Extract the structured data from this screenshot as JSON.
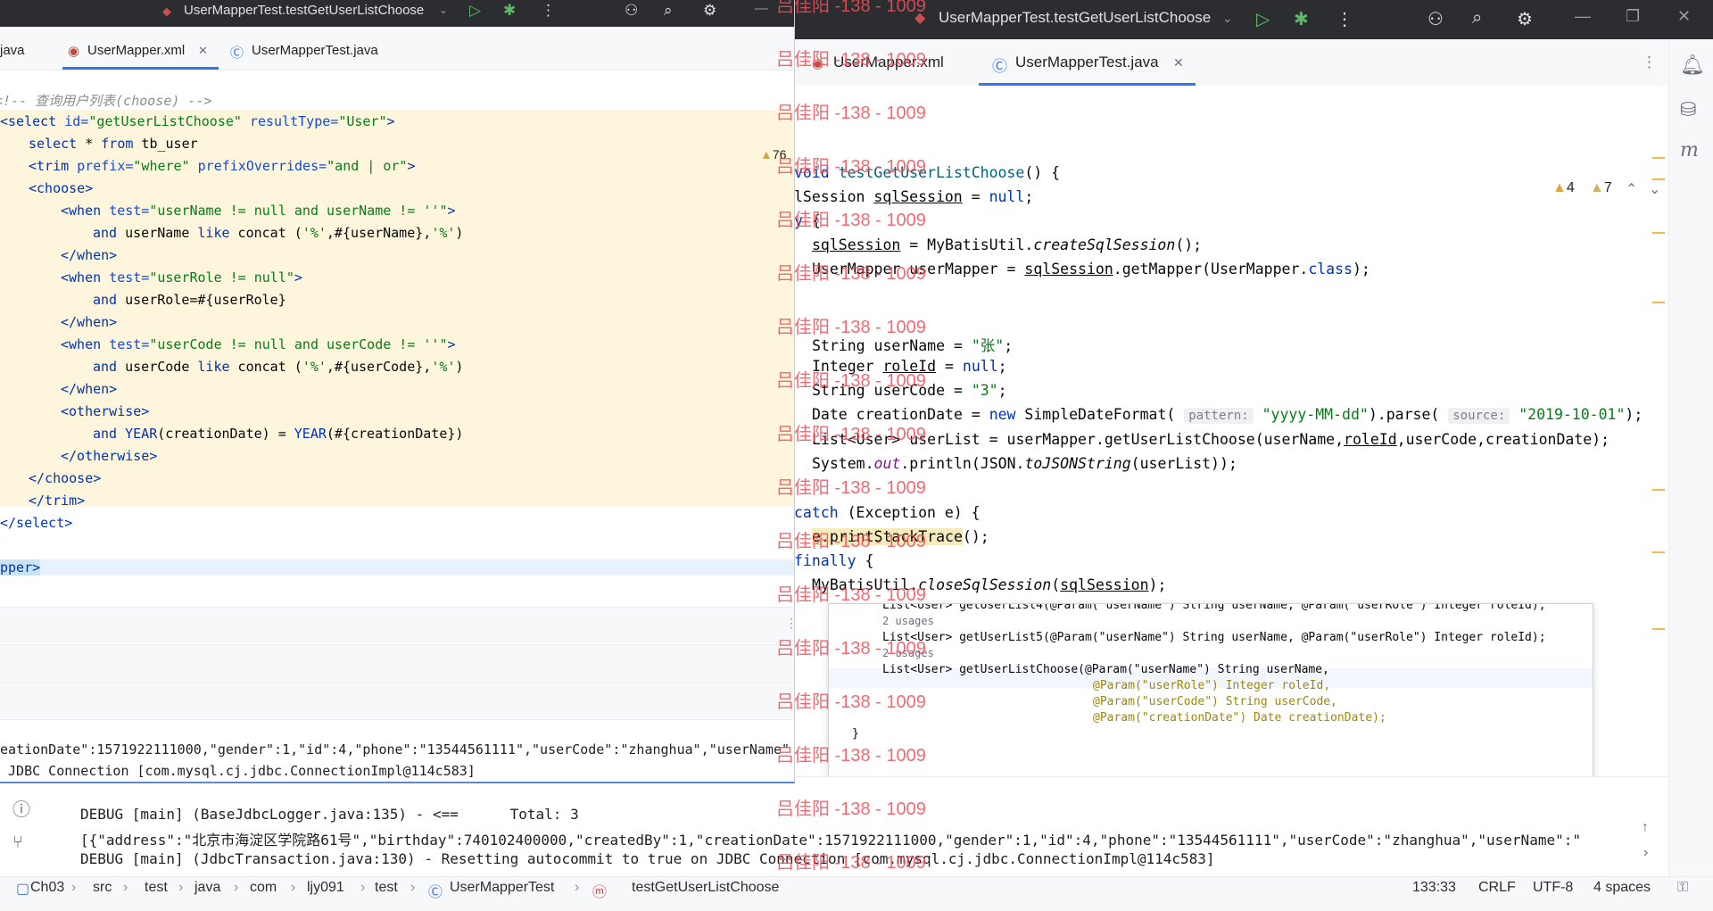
{
  "right_window": {
    "run_config": "UserMapperTest.testGetUserListChoose",
    "tabs": [
      {
        "label": "UserMapper.xml",
        "active": false
      },
      {
        "label": "UserMapperTest.java",
        "active": true
      }
    ],
    "warnings": {
      "a": "4",
      "b": "7"
    },
    "code_lines": [
      "void testGetUserListChoose() {",
      "lSession sqlSession = null;",
      "y {",
      "sqlSession = MyBatisUtil.createSqlSession();",
      "UserMapper userMapper = sqlSession.getMapper(UserMapper.class);",
      "String userName = \"张\";",
      "Integer roleId = null;",
      "String userCode = \"3\";",
      "Date creationDate = new SimpleDateFormat( pattern: \"yyyy-MM-dd\").parse( source: \"2019-10-01\");",
      "List<User> userList = userMapper.getUserListChoose(userName,roleId,userCode,creationDate);",
      "System.out.println(JSON.toJSONString(userList));",
      "catch (Exception e) {",
      "e.printStackTrace();",
      "finally {",
      "MyBatisUtil.closeSqlSession(sqlSession);"
    ],
    "hints": {
      "pattern": "pattern:",
      "source": "source:"
    },
    "popup": {
      "top_line": "List<User> getUserList4(@Param(\"userName\") String userName, @Param(\"userRole\") Integer roleId);",
      "usages1": "2 usages",
      "line5": "List<User> getUserList5(@Param(\"userName\") String userName, @Param(\"userRole\") Integer roleId);",
      "usages2": "2 usages",
      "choose1": "List<User> getUserListChoose(@Param(\"userName\") String userName,",
      "choose2": "@Param(\"userRole\") Integer roleId,",
      "choose3": "@Param(\"userCode\") String userCode,",
      "choose4": "@Param(\"creationDate\") Date creationDate);",
      "close": "}"
    },
    "run_output": [
      "DEBUG [main] (BaseJdbcLogger.java:135) - <==      Total: 3",
      "[{\"address\":\"北京市海淀区学院路61号\",\"birthday\":740102400000,\"createdBy\":1,\"creationDate\":1571922111000,\"gender\":1,\"id\":4,\"phone\":\"13544561111\",\"userCode\":\"zhanghua\",\"userName\":\"",
      "DEBUG [main] (JdbcTransaction.java:130) - Resetting autocommit to true on JDBC Connection [com.mysql.cj.jdbc.ConnectionImpl@114c583]"
    ],
    "status_bar": {
      "breadcrumbs": [
        "Ch03",
        "src",
        "test",
        "java",
        "com",
        "ljy091",
        "test",
        "UserMapperTest",
        "testGetUserListChoose"
      ],
      "position": "133:33",
      "line_sep": "CRLF",
      "encoding": "UTF-8",
      "indent": "4 spaces"
    }
  },
  "left_window": {
    "run_config": "UserMapperTest.testGetUserListChoose",
    "tabs": [
      {
        "label": "java",
        "active": false
      },
      {
        "label": "UserMapper.xml",
        "active": true
      },
      {
        "label": "UserMapperTest.java",
        "active": false
      }
    ],
    "warning_count": "76",
    "xml_lines": [
      "<!-- 查询用户列表(choose) -->",
      "<select id=\"getUserListChoose\" resultType=\"User\">",
      "    select * from tb_user",
      "    <trim prefix=\"where\" prefixOverrides=\"and | or\">",
      "    <choose>",
      "        <when test=\"userName != null and userName != ''\">",
      "            and userName like concat ('%',#{userName},'%')",
      "        </when>",
      "        <when test=\"userRole != null\">",
      "            and userRole=#{userRole}",
      "        </when>",
      "        <when test=\"userCode != null and userCode != ''\">",
      "            and userCode like concat ('%',#{userCode},'%')",
      "        </when>",
      "        <otherwise>",
      "            and YEAR(creationDate) = YEAR(#{creationDate})",
      "        </otherwise>",
      "    </choose>",
      "    </trim>",
      "</select>",
      "",
      "pper>"
    ],
    "output": [
      "eationDate\":1571922111000,\"gender\":1,\"id\":4,\"phone\":\"13544561111\",\"userCode\":\"zhanghua\",\"userName\"",
      " JDBC Connection [com.mysql.cj.jdbc.ConnectionImpl@114c583]"
    ]
  },
  "watermark": "吕佳阳 -138 - 1009",
  "colors": {
    "keyword": "#0033b3",
    "string": "#067d17",
    "accent": "#3574f0",
    "xml_highlight": "#fdf5dc",
    "watermark": "#f0505a"
  }
}
